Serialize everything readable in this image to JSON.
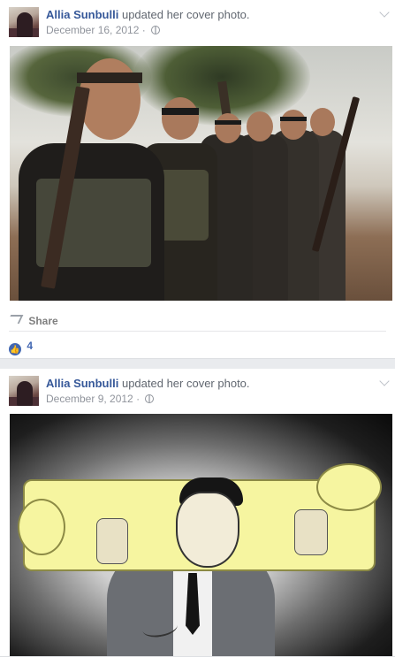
{
  "posts": [
    {
      "author": "Allia Sunbulli",
      "action": "updated her cover photo.",
      "date": "December 16, 2012",
      "share_label": "Share",
      "like_count": "4"
    },
    {
      "author": "Allia Sunbulli",
      "action": "updated her cover photo.",
      "date": "December 9, 2012"
    }
  ],
  "icons": {
    "audience": "globe-icon",
    "share": "share-arrow-icon",
    "like": "like-thumb-icon",
    "menu": "chevron-down-icon"
  },
  "colors": {
    "author_link": "#365899",
    "like_blue": "#4267b2",
    "background": "#e9ebee"
  }
}
